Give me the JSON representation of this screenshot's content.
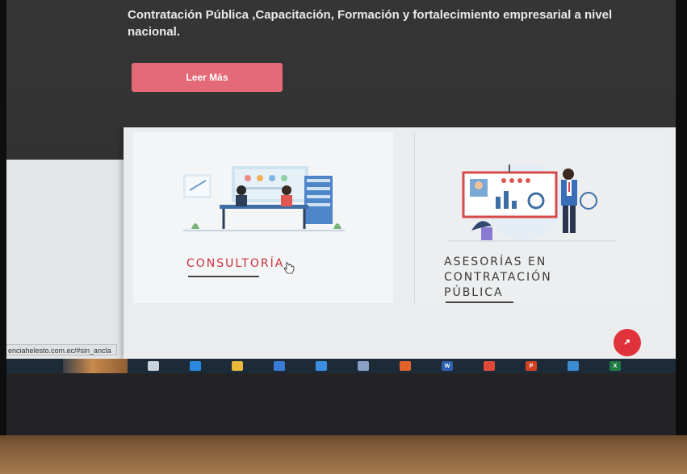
{
  "hero": {
    "text": "Contratación Pública ,Capacitación, Formación y fortalecimiento empresarial a nivel nacional.",
    "button_label": "Leer Más"
  },
  "cards": [
    {
      "title": "CONSULTORÍA",
      "illustration": "meeting-illustration"
    },
    {
      "title": "ASESORÍAS EN\nCONTRATACIÓN\nPÚBLICA",
      "illustration": "presentation-illustration"
    }
  ],
  "status_url": "enciahelesto.com.ec/#sin_ancla",
  "scroll_top_icon": "arrow-up-icon",
  "taskbar": {
    "icons": [
      {
        "name": "task-view-icon",
        "color": "#c9d3de"
      },
      {
        "name": "edge-icon",
        "color": "#2b8ae0"
      },
      {
        "name": "file-explorer-icon",
        "color": "#e8b93a"
      },
      {
        "name": "store-icon",
        "color": "#3a7bd5"
      },
      {
        "name": "mail-icon",
        "color": "#3a8fe0"
      },
      {
        "name": "photos-icon",
        "color": "#8a9fc4"
      },
      {
        "name": "firefox-icon",
        "color": "#e2622a"
      },
      {
        "name": "word-icon",
        "color": "#2f5fb0",
        "glyph": "W"
      },
      {
        "name": "chrome-icon",
        "color": "#e04a3a"
      },
      {
        "name": "powerpoint-icon",
        "color": "#d04423",
        "glyph": "P"
      },
      {
        "name": "photos-app-icon",
        "color": "#3b8bd0"
      },
      {
        "name": "excel-icon",
        "color": "#1f7a44",
        "glyph": "X"
      }
    ]
  },
  "colors": {
    "accent_button": "#e46a78",
    "title_red": "#c9323f",
    "scroll_button": "#e0323a"
  }
}
